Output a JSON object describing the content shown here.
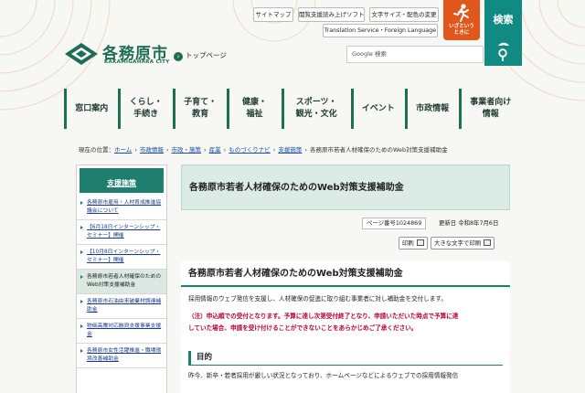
{
  "header": {
    "util_links": [
      "サイトマップ",
      "閲覧支援読み上げソフト",
      "文字サイズ・配色の変更"
    ],
    "translation": "Translation Service・Foreign Language",
    "emergency_label": "いざという\nときに",
    "search_label": "検索",
    "search_placeholder": "Google 検索",
    "logo_name": "各務原市",
    "logo_sub": "KAKAMIGAHARA CITY",
    "top_link": "トップページ",
    "colors": {
      "brand": "#1e6e57",
      "search": "#118a83",
      "emergency": "#e0561b"
    }
  },
  "gnav": [
    "窓口案内",
    "くらし・\n手続き",
    "子育て・\n教育",
    "健康・\n福祉",
    "スポーツ・\n観光・文化",
    "イベント",
    "市政情報",
    "事業者向け\n情報"
  ],
  "breadcrumb": {
    "prefix": "現在の位置：",
    "links": [
      "ホーム",
      "市政情報",
      "市政・施策",
      "産業",
      "ものづくりナビ",
      "支援施策"
    ],
    "current": "各務原市若者人材確保のためのWeb対策支援補助金"
  },
  "sidebar": {
    "heading": "支援施策",
    "items": [
      {
        "label": "各務原市雇用・人材育成推進協議会について",
        "active": false
      },
      {
        "label": "【6月18日インターンシップ・セミナー】開催",
        "active": false
      },
      {
        "label": "【10月8日インターンシップ・セミナー】開催",
        "active": false
      },
      {
        "label": "各務原市若者人材確保のためのWeb対策支援補助金",
        "active": true
      },
      {
        "label": "各務原市石油由来破棄材調達補助金",
        "active": false
      },
      {
        "label": "物価高騰対応融資支援事業支援金",
        "active": false
      },
      {
        "label": "各務原市女性活躍推進・職場環境改善補助金",
        "active": false
      }
    ]
  },
  "main": {
    "title": "各務原市若者人材確保のためのWeb対策支援補助金",
    "page_no": "ページ番号1024869",
    "updated": "更新日 令和8年7月6日",
    "print_label": "印刷",
    "print_large_label": "大きな文字で印刷",
    "section_title": "各務原市若者人材確保のためのWeb対策支援補助金",
    "intro": "採用情報のウェブ発信を支援し、人材確保の促進に取り組む事業者に対し補助金を交付します。",
    "notice_line1": "（注）申込順での受付となります。予算に達し次第受付終了となり、申請いただいた時点で予算に達",
    "notice_line2": "していた場合、申請を受け付けることができないことをあらかじめご了承ください。",
    "heading_purpose": "目的",
    "purpose_text": "昨今、新卒・若者採用が厳しい状況となっており、ホームページなどによるウェブでの採用情報発信"
  }
}
